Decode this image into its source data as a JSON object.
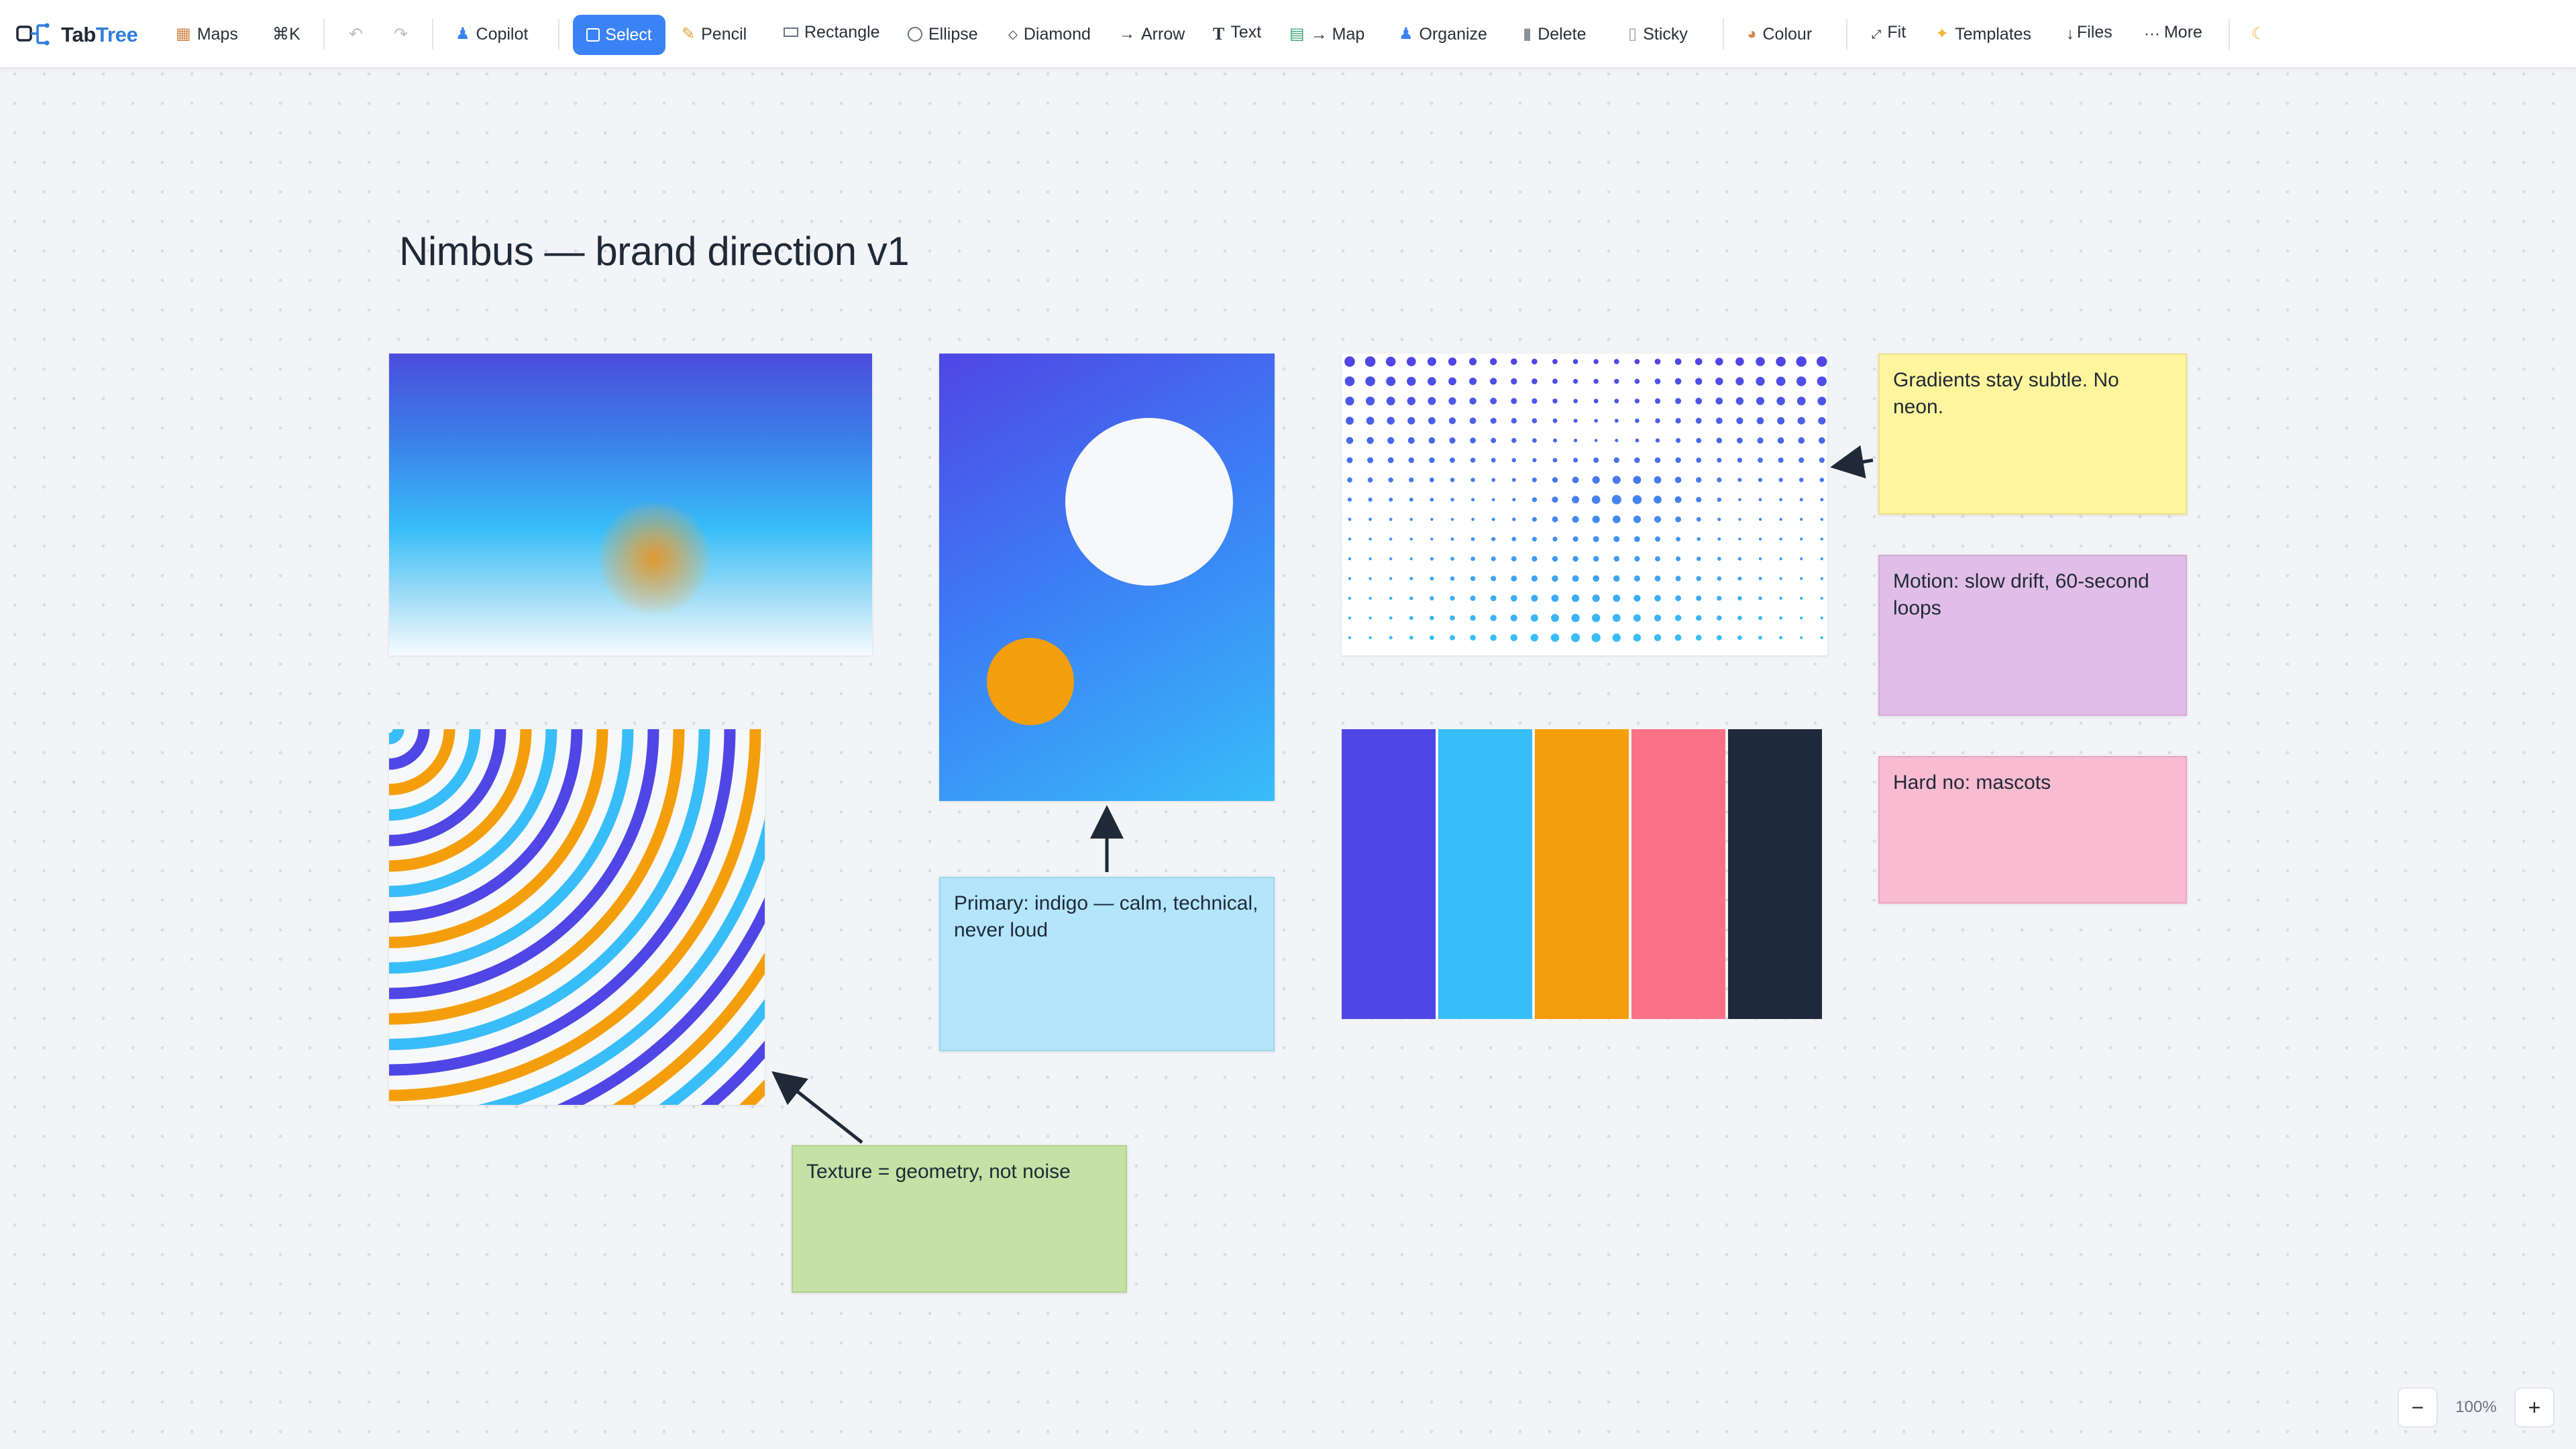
{
  "app": {
    "name_prefix": "Tab",
    "name_accent": "Tree"
  },
  "toolbar": {
    "items": [
      {
        "key": "maps",
        "label": "Maps",
        "icon": "map-folder-icon"
      },
      {
        "key": "cmdk",
        "label": "⌘K"
      },
      {
        "key": "undo",
        "label": "↶",
        "icon": "undo-icon"
      },
      {
        "key": "redo",
        "label": "↷",
        "icon": "redo-icon"
      },
      {
        "key": "copilot",
        "label": "Copilot",
        "icon": "copilot-icon"
      },
      {
        "key": "select",
        "label": "Select",
        "icon": "select-icon",
        "active": true
      },
      {
        "key": "pencil",
        "label": "Pencil",
        "icon": "pencil-icon"
      },
      {
        "key": "rectangle",
        "label": "Rectangle",
        "icon": "rectangle-icon"
      },
      {
        "key": "ellipse",
        "label": "Ellipse",
        "icon": "ellipse-icon"
      },
      {
        "key": "diamond",
        "label": "Diamond",
        "icon": "diamond-icon"
      },
      {
        "key": "arrow",
        "label": "Arrow",
        "icon": "arrow-icon"
      },
      {
        "key": "text",
        "label": "Text",
        "icon": "text-icon"
      },
      {
        "key": "map",
        "label": "→ Map",
        "icon": "map-icon"
      },
      {
        "key": "organize",
        "label": "Organize",
        "icon": "organize-icon"
      },
      {
        "key": "delete",
        "label": "Delete",
        "icon": "trash-icon"
      },
      {
        "key": "sticky",
        "label": "Sticky",
        "icon": "sticky-note-icon"
      },
      {
        "key": "colour",
        "label": "Colour",
        "icon": "palette-icon"
      },
      {
        "key": "fit",
        "label": "Fit",
        "icon": "fit-icon"
      },
      {
        "key": "templates",
        "label": "Templates",
        "icon": "sparkles-icon"
      },
      {
        "key": "files",
        "label": "Files",
        "icon": "download-icon"
      },
      {
        "key": "more",
        "label": "More",
        "icon": "more-icon"
      },
      {
        "key": "theme",
        "label": "",
        "icon": "moon-icon"
      }
    ]
  },
  "canvas": {
    "title": "Nimbus — brand direction v1",
    "palette": [
      "#4f46e5",
      "#38bdf8",
      "#f59e0b",
      "#fb7185",
      "#1e293b"
    ],
    "colors": {
      "indigo": "#4f46e5",
      "sky": "#38bdf8",
      "amber": "#f59e0b",
      "white": "#f7f8fa"
    },
    "stickies": {
      "gradients": "Gradients stay subtle. No neon.",
      "motion": "Motion: slow drift, 60-second loops",
      "hard_no": "Hard no: mascots",
      "primary": "Primary: indigo — calm, technical, never loud",
      "texture": "Texture = geometry, not noise"
    }
  },
  "zoom": {
    "minus": "−",
    "level": "100%",
    "plus": "+"
  }
}
